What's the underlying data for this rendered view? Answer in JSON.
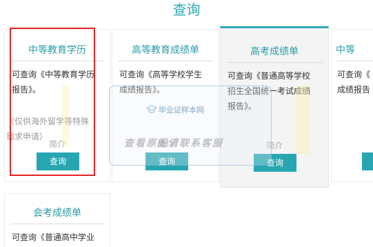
{
  "page": {
    "title": "查询"
  },
  "cards": [
    {
      "title": "中等教育学历",
      "desc": "可查询《中等教育学历\n报告》。",
      "note": "（仅供海外留学等特殊\n需求申请）",
      "intro": "简介",
      "button": "查询"
    },
    {
      "title": "高等教育成绩单",
      "desc": "可查询《高等学校学生\n成绩报告》。",
      "intro": "简介",
      "button": "查询"
    },
    {
      "title": "高考成绩单",
      "desc": "可查询《普通高等学校\n招生全国统一考试成绩\n报告》。",
      "intro": "简介",
      "button": "查询"
    },
    {
      "title": "中等",
      "desc": "可查询《\n成绩报告",
      "button": ""
    },
    {
      "title": "会考成绩单",
      "desc": "可查询《普通高中学业"
    }
  ],
  "watermark": {
    "brand": "毕业证样本网",
    "contact": "查看原图请联系客服"
  },
  "colors": {
    "accent": "#27a6b2",
    "highlight": "#e52222"
  }
}
